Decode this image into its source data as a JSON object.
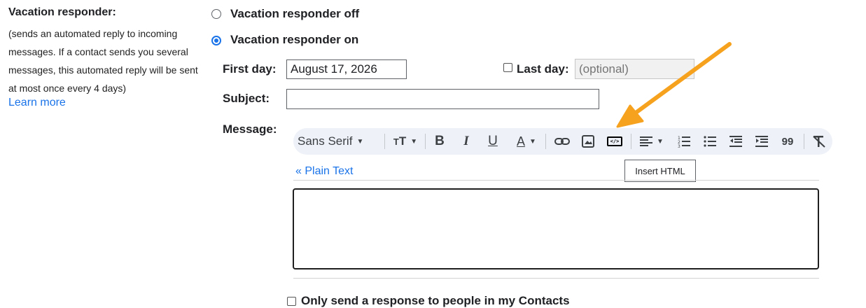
{
  "section": {
    "title": "Vacation responder:",
    "description": "(sends an automated reply to incoming messages. If a contact sends you several messages, this automated reply will be sent at most once every 4 days)",
    "learn_more": "Learn more"
  },
  "options": {
    "off_label": "Vacation responder off",
    "on_label": "Vacation responder on",
    "selected": "on"
  },
  "form": {
    "first_day_label": "First day:",
    "first_day_value": "August 17, 2026",
    "last_day_label": "Last day:",
    "last_day_placeholder": "(optional)",
    "subject_label": "Subject:",
    "subject_value": "",
    "message_label": "Message:"
  },
  "toolbar": {
    "font_name": "Sans Serif",
    "insert_html_tooltip": "Insert HTML"
  },
  "editor": {
    "plain_text_link": "« Plain Text",
    "content": ""
  },
  "bottom": {
    "partial_text": "Only send a response to people in my Contacts"
  },
  "colors": {
    "accent": "#1a73e8",
    "toolbar_bg": "#eef1f8",
    "arrow": "#f6a21e"
  },
  "icons": [
    "font-size-icon",
    "bold-icon",
    "italic-icon",
    "underline-icon",
    "text-color-icon",
    "link-icon",
    "image-icon",
    "insert-html-icon",
    "align-icon",
    "numbered-list-icon",
    "bulleted-list-icon",
    "indent-less-icon",
    "indent-more-icon",
    "quote-icon",
    "remove-formatting-icon"
  ]
}
